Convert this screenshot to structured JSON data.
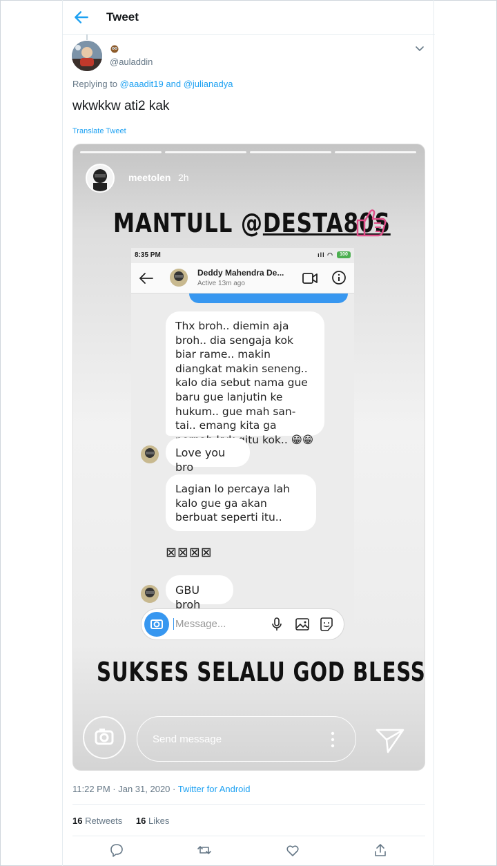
{
  "header": {
    "title": "Tweet",
    "back_icon": "arrow-left-icon"
  },
  "tweet": {
    "emoji": "owl",
    "handle": "@auladdin",
    "replying_prefix": "Replying to",
    "reply_user_1": "@aaadit19",
    "reply_and": "and",
    "reply_user_2": "@julianadya",
    "text": "wkwkkw ati2 kak",
    "translate": "Translate Tweet"
  },
  "story": {
    "username": "meetolen",
    "time": "2h",
    "headline_prefix": "MANTULL @",
    "headline_mention": "DESTA80S",
    "footer": "SUKSES SELALU GOD BLESS!",
    "send_placeholder": "Send message",
    "phone": {
      "status_time": "8:35 PM",
      "battery": "100",
      "contact_name": "Deddy Mahendra  De...",
      "active": "Active 13m ago",
      "messages": [
        "Thx broh.. diemin aja broh.. dia sengaja kok biar rame.. makin diangkat makin seneng.. kalo dia sebut nama gue baru gue lanjutin ke hukum.. gue mah san-tai.. emang kita ga pernah kyk gitu kok.. 😁😁😁",
        "Love you bro",
        "Lagian lo percaya lah kalo gue ga akan berbuat seperti itu..",
        "GBU broh"
      ],
      "boxes": "⊠⊠⊠⊠",
      "input_placeholder": "Message..."
    }
  },
  "meta": {
    "time_date": "11:22 PM · Jan 31, 2020 · ",
    "source": "Twitter for Android"
  },
  "stats": {
    "retweets_count": "16",
    "retweets_label": "Retweets",
    "likes_count": "16",
    "likes_label": "Likes"
  },
  "colors": {
    "accent": "#1da1f2",
    "muted": "#657786",
    "ig_blue": "#3797f0"
  }
}
